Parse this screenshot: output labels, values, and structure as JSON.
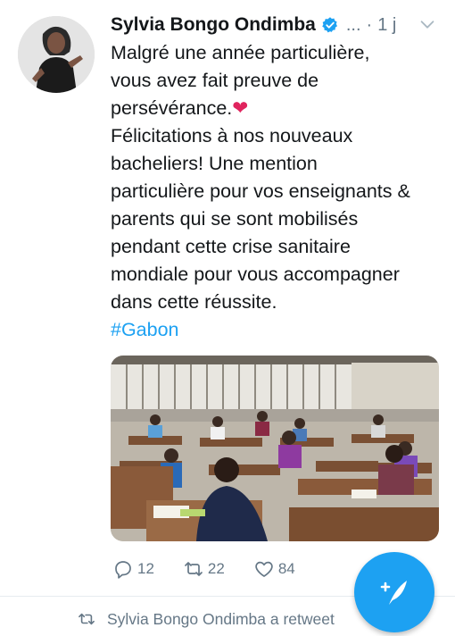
{
  "tweet": {
    "author_name": "Sylvia Bongo Ondimba",
    "handle": "...",
    "dot": "·",
    "time": "1 j",
    "text_line1": "Malgré une année particulière,",
    "text_line2": "vous avez fait preuve de",
    "text_line3": "persévérance.",
    "text_line4": "Félicitations à nos nouveaux",
    "text_line5": "bacheliers! Une mention",
    "text_line6": "particulière pour vos enseignants &",
    "text_line7": "parents qui se sont mobilisés",
    "text_line8": "pendant cette crise sanitaire",
    "text_line9": "mondiale pour vous accompagner",
    "text_line10": "dans cette réussite.",
    "hashtag": "#Gabon",
    "heart_emoji": "❤"
  },
  "actions": {
    "replies": "12",
    "retweets": "22",
    "likes": "84"
  },
  "retweet_banner": {
    "text": "Sylvia Bongo Ondimba a retweet"
  },
  "icons": {
    "verified": "verified-badge-icon",
    "caret": "chevron-down-icon",
    "reply": "reply-icon",
    "retweet": "retweet-icon",
    "like": "heart-icon",
    "compose": "compose-tweet-icon"
  },
  "colors": {
    "accent": "#1da1f2",
    "secondary_text": "#657786",
    "heart": "#e0245e"
  }
}
